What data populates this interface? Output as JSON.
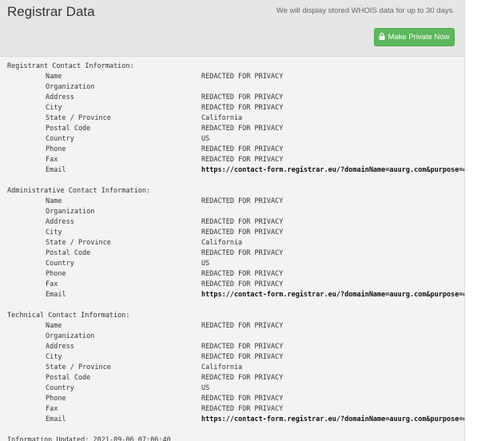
{
  "header": {
    "title": "Registrar Data",
    "notice": "We will display stored WHOIS data for up to 30 days.",
    "button_label": "Make Private Now",
    "button_icon": "lock-icon",
    "button_color": "#5cb85c"
  },
  "sections": [
    {
      "heading": "Registrant Contact Information:",
      "fields": [
        {
          "name": "Name",
          "value": "REDACTED FOR PRIVACY"
        },
        {
          "name": "Organization",
          "value": ""
        },
        {
          "name": "Address",
          "value": "REDACTED FOR PRIVACY"
        },
        {
          "name": "City",
          "value": "REDACTED FOR PRIVACY"
        },
        {
          "name": "State / Province",
          "value": "California"
        },
        {
          "name": "Postal Code",
          "value": "REDACTED FOR PRIVACY"
        },
        {
          "name": "Country",
          "value": "US"
        },
        {
          "name": "Phone",
          "value": "REDACTED FOR PRIVACY"
        },
        {
          "name": "Fax",
          "value": "REDACTED FOR PRIVACY"
        },
        {
          "name": "Email",
          "value": "https://contact-form.registrar.eu/?domainName=auurg.com&purpose=owner"
        }
      ]
    },
    {
      "heading": "Administrative Contact Information:",
      "fields": [
        {
          "name": "Name",
          "value": "REDACTED FOR PRIVACY"
        },
        {
          "name": "Organization",
          "value": ""
        },
        {
          "name": "Address",
          "value": "REDACTED FOR PRIVACY"
        },
        {
          "name": "City",
          "value": "REDACTED FOR PRIVACY"
        },
        {
          "name": "State / Province",
          "value": "California"
        },
        {
          "name": "Postal Code",
          "value": "REDACTED FOR PRIVACY"
        },
        {
          "name": "Country",
          "value": "US"
        },
        {
          "name": "Phone",
          "value": "REDACTED FOR PRIVACY"
        },
        {
          "name": "Fax",
          "value": "REDACTED FOR PRIVACY"
        },
        {
          "name": "Email",
          "value": "https://contact-form.registrar.eu/?domainName=auurg.com&purpose=owner"
        }
      ]
    },
    {
      "heading": "Technical Contact Information:",
      "fields": [
        {
          "name": "Name",
          "value": "REDACTED FOR PRIVACY"
        },
        {
          "name": "Organization",
          "value": ""
        },
        {
          "name": "Address",
          "value": "REDACTED FOR PRIVACY"
        },
        {
          "name": "City",
          "value": "REDACTED FOR PRIVACY"
        },
        {
          "name": "State / Province",
          "value": "California"
        },
        {
          "name": "Postal Code",
          "value": "REDACTED FOR PRIVACY"
        },
        {
          "name": "Country",
          "value": "US"
        },
        {
          "name": "Phone",
          "value": "REDACTED FOR PRIVACY"
        },
        {
          "name": "Fax",
          "value": "REDACTED FOR PRIVACY"
        },
        {
          "name": "Email",
          "value": "https://contact-form.registrar.eu/?domainName=auurg.com&purpose=owner"
        }
      ]
    }
  ],
  "footer": {
    "updated": "Information Updated: 2021-09-06 07:06:40"
  }
}
